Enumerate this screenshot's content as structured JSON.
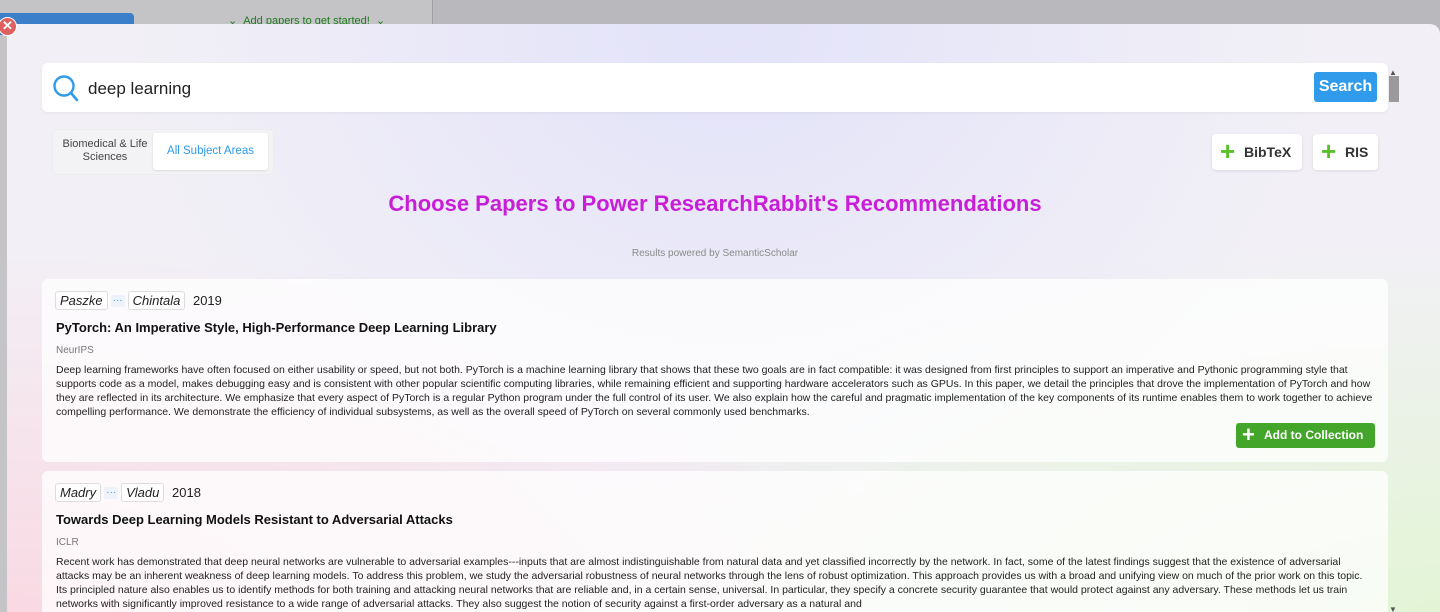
{
  "background": {
    "hint": "Add papers to get started!",
    "hint_arrow_left": "⌄",
    "hint_arrow_right": "⌄"
  },
  "modal": {
    "close_glyph": "✕",
    "search": {
      "value": "deep learning",
      "button_label": "Search"
    },
    "subjects": {
      "option1": "Biomedical & Life Sciences",
      "option2": "All Subject Areas",
      "selected": "All Subject Areas"
    },
    "exports": {
      "bibtex": "BibTeX",
      "ris": "RIS"
    },
    "headline": "Choose Papers to Power ResearchRabbit's Recommendations",
    "powered_by": "Results powered by SemanticScholar",
    "papers": [
      {
        "author_first": "Paszke",
        "author_last": "Chintala",
        "more": "···",
        "year": "2019",
        "title": "PyTorch: An Imperative Style, High-Performance Deep Learning Library",
        "venue": "NeurIPS",
        "abstract": "Deep learning frameworks have often focused on either usability or speed, but not both. PyTorch is a machine learning library that shows that these two goals are in fact compatible: it was designed from first principles to support an imperative and Pythonic programming style that supports code as a model, makes debugging easy and is consistent with other popular scientific computing libraries, while remaining efficient and supporting hardware accelerators such as GPUs. In this paper, we detail the principles that drove the implementation of PyTorch and how they are reflected in its architecture. We emphasize that every aspect of PyTorch is a regular Python program under the full control of its user. We also explain how the careful and pragmatic implementation of the key components of its runtime enables them to work together to achieve compelling performance. We demonstrate the efficiency of individual subsystems, as well as the overall speed of PyTorch on several commonly used benchmarks.",
        "add_label": "Add to Collection"
      },
      {
        "author_first": "Madry",
        "author_last": "Vladu",
        "more": "···",
        "year": "2018",
        "title": "Towards Deep Learning Models Resistant to Adversarial Attacks",
        "venue": "ICLR",
        "abstract": "Recent work has demonstrated that deep neural networks are vulnerable to adversarial examples---inputs that are almost indistinguishable from natural data and yet classified incorrectly by the network. In fact, some of the latest findings suggest that the existence of adversarial attacks may be an inherent weakness of deep learning models. To address this problem, we study the adversarial robustness of neural networks through the lens of robust optimization. This approach provides us with a broad and unifying view on much of the prior work on this topic. Its principled nature also enables us to identify methods for both training and attacking neural networks that are reliable and, in a certain sense, universal. In particular, they specify a concrete security guarantee that would protect against any adversary. These methods let us train networks with significantly improved resistance to a wide range of adversarial attacks. They also suggest the notion of security against a first-order adversary as a natural and"
      }
    ]
  },
  "colors": {
    "headline": "#c81ed8",
    "search_button": "#2f9bea",
    "add_button": "#43a52a",
    "plus_icon": "#5ac12a"
  }
}
